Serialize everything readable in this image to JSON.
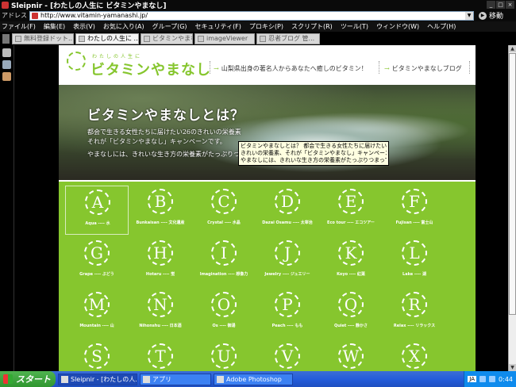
{
  "window": {
    "title": "Sleipnir - [わたしの人生に ビタミンやまなし]",
    "btn_min": "_",
    "btn_max": "□",
    "btn_close": "×"
  },
  "address": {
    "label": "アドレス",
    "url": "http://www.vitamin-yamanashi.jp/",
    "go_label": "移動"
  },
  "menu": [
    "ファイル(F)",
    "編集(E)",
    "表示(V)",
    "お気に入り(A)",
    "グループ(G)",
    "セキュリティ(F)",
    "プロキシ(P)",
    "スクリプト(R)",
    "ツール(T)",
    "ウィンドウ(W)",
    "ヘルプ(H)"
  ],
  "tabs": [
    "無料登録ドット...",
    "わたしの人生に ...",
    "ビタミンやまなし...",
    "imageViewer",
    "忍者ブログ 管..."
  ],
  "site": {
    "logo_sub": "わたしの人生に",
    "logo_text": "ビタミンやまなし",
    "header_link_1": "山梨県出身の著名人からあなたへ癒しのビタミン！",
    "header_link_2": "ビタミンやまなしブログ",
    "arrow": "→"
  },
  "hero": {
    "title": "ビタミンやまなしとは？",
    "line1": "都会で生きる女性たちに届けたい26のきれいの栄養素",
    "line2": "それが「ビタミンやまなし」キャンペーンです。",
    "line3": "やまなしには、きれいな生き方の栄養素がたっぷりつまっています。"
  },
  "tooltip": [
    "ビタミンやまなしとは？ 都会で生きる女性たちに届けたい26の",
    "きれいの栄養素、それが「ビタミンやまなし」キャンペーンです。",
    "やまなしには、きれいな生き方の栄養素がたっぷりつまっています。"
  ],
  "grid": [
    {
      "letter": "A",
      "caption": "Aqua ---- 水"
    },
    {
      "letter": "B",
      "caption": "Bunkaisan ---- 文化遺産"
    },
    {
      "letter": "C",
      "caption": "Crystal ---- 水晶"
    },
    {
      "letter": "D",
      "caption": "Dazai Osamu ---- 太宰治"
    },
    {
      "letter": "E",
      "caption": "Eco tour ---- エコツアー"
    },
    {
      "letter": "F",
      "caption": "Fujisan ---- 富士山"
    },
    {
      "letter": "G",
      "caption": "Grape ---- ぶどう"
    },
    {
      "letter": "H",
      "caption": "Hotaru ---- 蛍"
    },
    {
      "letter": "I",
      "caption": "Imagination ---- 想像力"
    },
    {
      "letter": "J",
      "caption": "Jewelry ---- ジュエリー"
    },
    {
      "letter": "K",
      "caption": "Koyo ---- 紅葉"
    },
    {
      "letter": "L",
      "caption": "Lake ---- 湖"
    },
    {
      "letter": "M",
      "caption": "Mountain ---- 山"
    },
    {
      "letter": "N",
      "caption": "Nihonshu ---- 日本酒"
    },
    {
      "letter": "O",
      "caption": "Os ---- 御湯"
    },
    {
      "letter": "P",
      "caption": "Peach ---- もも"
    },
    {
      "letter": "Q",
      "caption": "Quiet ---- 静かさ"
    },
    {
      "letter": "R",
      "caption": "Relax ---- リラックス"
    },
    {
      "letter": "S",
      "caption": ""
    },
    {
      "letter": "T",
      "caption": ""
    },
    {
      "letter": "U",
      "caption": ""
    },
    {
      "letter": "V",
      "caption": ""
    },
    {
      "letter": "W",
      "caption": ""
    },
    {
      "letter": "X",
      "caption": ""
    }
  ],
  "taskbar": {
    "start": "スタート",
    "tasks": [
      "Sleipnir - [わたしの人...",
      "アプリ",
      "Adobe Photoshop"
    ],
    "ime": "JA",
    "clock": "0:44"
  },
  "colors": {
    "accent": "#86c62e",
    "grid_bg": "#86c62e"
  }
}
